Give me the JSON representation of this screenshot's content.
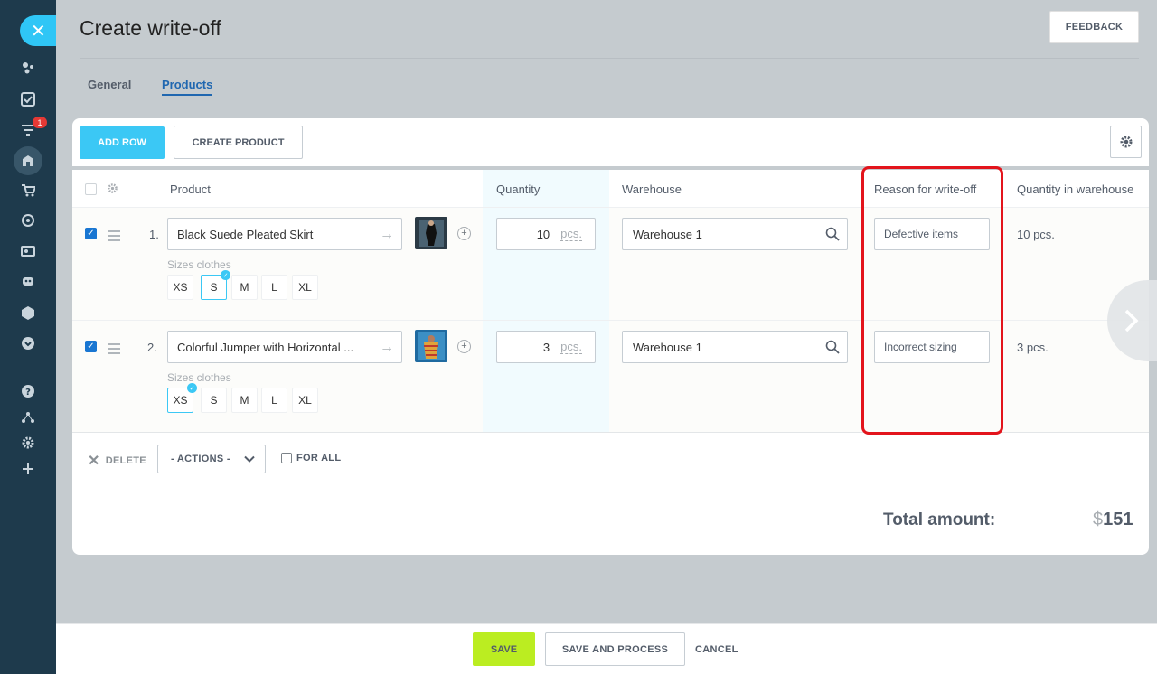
{
  "header": {
    "title": "Create write-off",
    "feedback_label": "FEEDBACK"
  },
  "tabs": [
    {
      "label": "General",
      "active": false
    },
    {
      "label": "Products",
      "active": true
    }
  ],
  "sidebar": {
    "badge_count": "1",
    "icons": [
      "close-icon",
      "activity-icon",
      "tasks-icon",
      "funnel-icon",
      "store-icon",
      "cart-icon",
      "target-icon",
      "contact-card-icon",
      "robot-icon",
      "box-icon",
      "chevron-down-circle-icon",
      "help-icon",
      "network-icon",
      "gear-icon",
      "plus-icon"
    ]
  },
  "toolbar": {
    "add_row_label": "ADD ROW",
    "create_product_label": "CREATE PRODUCT"
  },
  "table": {
    "columns": [
      "Product",
      "Quantity",
      "Warehouse",
      "Reason for write-off",
      "Quantity in warehouse"
    ],
    "sizes_label": "Sizes clothes",
    "size_options": [
      "XS",
      "S",
      "M",
      "L",
      "XL"
    ],
    "rows": [
      {
        "number": "1.",
        "checked": true,
        "product": "Black Suede Pleated Skirt",
        "selected_size": "S",
        "quantity": "10",
        "unit": "pcs.",
        "warehouse": "Warehouse 1",
        "reason": "Defective items",
        "warehouse_qty": "10 pcs."
      },
      {
        "number": "2.",
        "checked": true,
        "product": "Colorful Jumper with Horizontal ...",
        "selected_size": "XS",
        "quantity": "3",
        "unit": "pcs.",
        "warehouse": "Warehouse 1",
        "reason": "Incorrect sizing",
        "warehouse_qty": "3 pcs."
      }
    ]
  },
  "footer": {
    "delete_label": "DELETE",
    "actions_label": "- ACTIONS -",
    "for_all_label": "FOR ALL",
    "total_label": "Total amount:",
    "total_currency": "$",
    "total_value": "151"
  },
  "bottom": {
    "save_label": "SAVE",
    "save_process_label": "SAVE AND PROCESS",
    "cancel_label": "CANCEL"
  },
  "colors": {
    "accent": "#3bc8f5",
    "save": "#bbed21",
    "highlight_box": "#e3141c",
    "link": "#2067b0"
  }
}
